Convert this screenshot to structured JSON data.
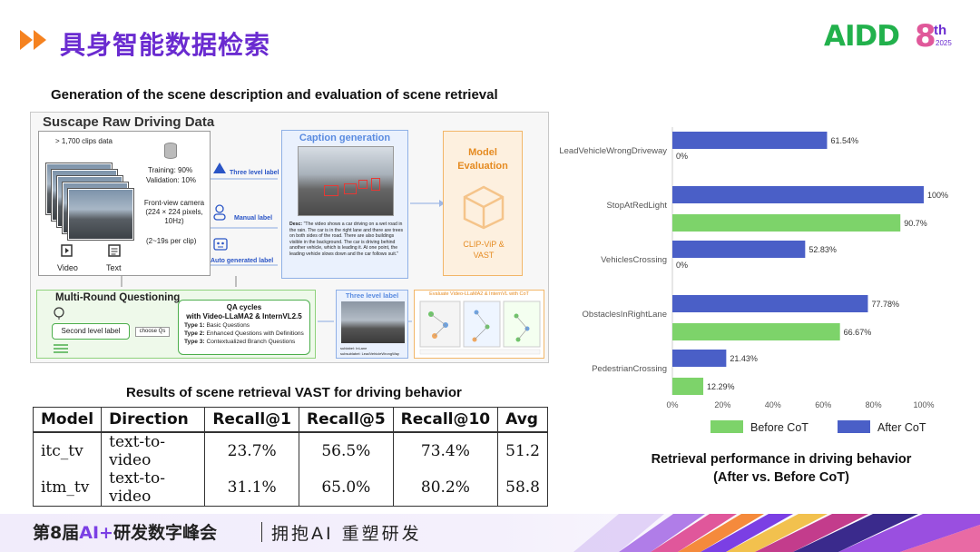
{
  "header": {
    "title": "具身智能数据检索"
  },
  "logo": {
    "text": "AIDD",
    "edition": "8",
    "suffix": "th",
    "year": "2025"
  },
  "left": {
    "figure_title": "Generation of the scene description and evaluation of scene retrieval",
    "table_title": "Results of scene retrieval VAST for driving behavior"
  },
  "pipeline": {
    "raw_title": "Suscape Raw Driving Data",
    "clips": "> 1,700 clips data",
    "split_train": "Training: 90%",
    "split_val": "Validation: 10%",
    "camera": "Front-view camera (224 × 224 pixels, 10Hz)",
    "duration": "(2~19s per clip)",
    "video": "Video",
    "text": "Text",
    "label_three": "Three level label",
    "label_manual": "Manual label",
    "label_auto": "Auto generated label",
    "caption_title": "Caption generation",
    "desc_key": "Desc:",
    "desc_text": "\"The video shows a car driving on a wet road in the rain. The car is in the right lane and there are trees on both sides of the road. There are also buildings visible in the background. The car is driving behind another vehicle, which is leading it. At one point, the leading vehicle slows down and the car follows suit.\"",
    "model_title": "Model Evaluation",
    "model_sub": "CLIP-ViP & VAST",
    "mrq_title": "Multi-Round Questioning",
    "second_label": "Second level label",
    "choose_qs": "choose Qs",
    "qa_head_1": "QA cycles",
    "qa_head_2": "with Video-LLaMA2 & InternVL2.5",
    "qa_t1_key": "Type 1:",
    "qa_t1": "Basic Questions",
    "qa_t2_key": "Type 2:",
    "qa_t2": "Enhanced Questions with Definitions",
    "qa_t3_key": "Type 3:",
    "qa_t3": "Contextualized Branch Questions",
    "tl_title": "Three level label",
    "tl_sub": "sublabel: InLane",
    "tl_subsub": "subsublabel: LeadVehicleWrongWay",
    "eval_title": "Evaluate Video-LLaMA2 & InternVL with CoT"
  },
  "table": {
    "headers": [
      "Model",
      "Direction",
      "Recall@1",
      "Recall@5",
      "Recall@10",
      "Avg"
    ],
    "rows": [
      [
        "itc_tv",
        "text-to-video",
        "23.7%",
        "56.5%",
        "73.4%",
        "51.2"
      ],
      [
        "itm_tv",
        "text-to-video",
        "31.1%",
        "65.0%",
        "80.2%",
        "58.8"
      ]
    ]
  },
  "chart_data": {
    "type": "bar",
    "orientation": "horizontal",
    "categories": [
      "LeadVehicleWrongDriveway",
      "StopAtRedLight",
      "VehiclesCrossing",
      "ObstaclesInRightLane",
      "PedestrianCrossing"
    ],
    "series": [
      {
        "name": "After CoT",
        "color": "#4a5fc7",
        "values": [
          61.54,
          100,
          52.83,
          77.78,
          21.43
        ],
        "labels": [
          "61.54%",
          "100%",
          "52.83%",
          "77.78%",
          "21.43%"
        ]
      },
      {
        "name": "Before CoT",
        "color": "#7dd36a",
        "values": [
          0,
          90.7,
          0,
          66.67,
          12.29
        ],
        "labels": [
          "0%",
          "90.7%",
          "0%",
          "66.67%",
          "12.29%"
        ]
      }
    ],
    "xlim": [
      0,
      100
    ],
    "xticks": [
      "0%",
      "20%",
      "40%",
      "60%",
      "80%",
      "100%"
    ],
    "legend_position": "bottom",
    "title": "Retrieval performance in driving behavior (After vs. Before CoT)"
  },
  "chart_caption": {
    "line1": "Retrieval performance in driving behavior",
    "line2": "(After vs. Before CoT)"
  },
  "footer": {
    "left_prefix": "第8届",
    "left_hl": "AI+",
    "left_suffix": "研发数字峰会",
    "right": "拥抱AI 重塑研发"
  }
}
